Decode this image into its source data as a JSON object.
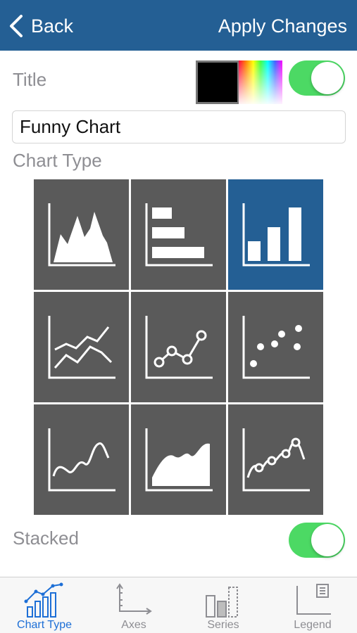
{
  "navbar": {
    "back_label": "Back",
    "apply_label": "Apply Changes"
  },
  "title_section": {
    "label": "Title",
    "value": "Funny Chart",
    "color": "#000000",
    "enabled": true
  },
  "chart_type_section": {
    "label": "Chart Type",
    "selected": "column",
    "options": [
      {
        "id": "area-peaks",
        "icon": "area-peaks-icon"
      },
      {
        "id": "horizontal-bar",
        "icon": "horizontal-bar-icon"
      },
      {
        "id": "column",
        "icon": "column-bar-icon"
      },
      {
        "id": "line",
        "icon": "line-chart-icon"
      },
      {
        "id": "line-markers",
        "icon": "line-markers-icon"
      },
      {
        "id": "scatter",
        "icon": "scatter-icon"
      },
      {
        "id": "spline",
        "icon": "spline-icon"
      },
      {
        "id": "spline-area",
        "icon": "spline-area-icon"
      },
      {
        "id": "spline-markers",
        "icon": "spline-markers-icon"
      }
    ]
  },
  "stacked": {
    "label": "Stacked",
    "enabled": true
  },
  "colors": {
    "nav": "#245f94",
    "tile": "#5a5a5a",
    "tile_selected": "#245f94",
    "toggle_on": "#4cd964",
    "tab_active": "#1d6fd6"
  },
  "tabs": [
    {
      "label": "Chart Type",
      "icon": "chart-type-icon",
      "active": true
    },
    {
      "label": "Axes",
      "icon": "axes-icon",
      "active": false
    },
    {
      "label": "Series",
      "icon": "series-icon",
      "active": false
    },
    {
      "label": "Legend",
      "icon": "legend-icon",
      "active": false
    }
  ]
}
